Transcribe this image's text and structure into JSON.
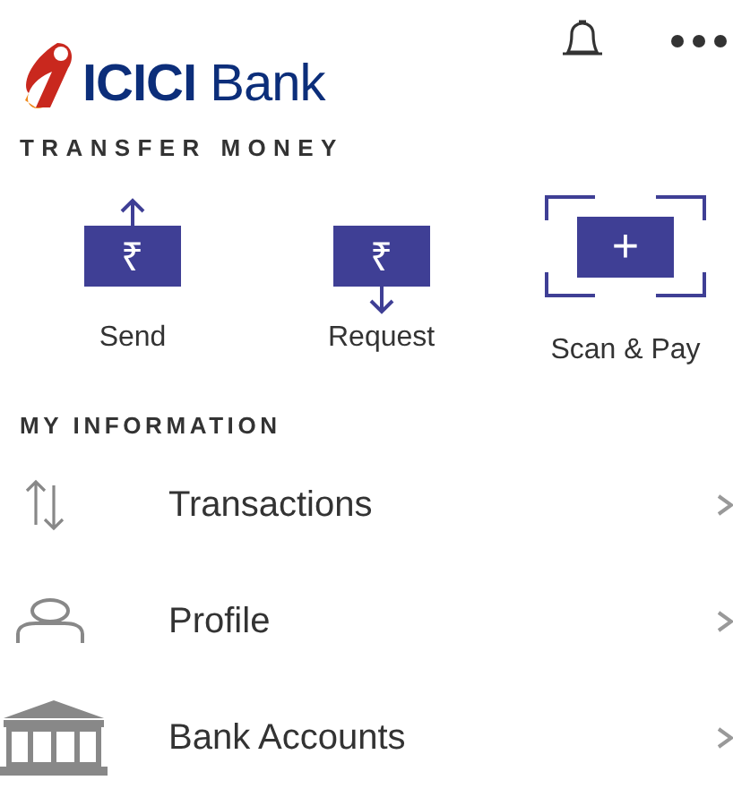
{
  "header": {
    "logo_text": "**ICICI** Bank"
  },
  "transfer_money": {
    "title": "TRANSFER MONEY",
    "actions": [
      {
        "kind": "send",
        "glyph": "₹",
        "label": "Send"
      },
      {
        "kind": "request",
        "glyph": "₹",
        "label": "Request"
      },
      {
        "kind": "scan",
        "glyph": "+",
        "label": "Scan & Pay"
      }
    ]
  },
  "my_information": {
    "title": "MY INFORMATION",
    "items": [
      {
        "kind": "transactions",
        "label": "Transactions"
      },
      {
        "kind": "profile",
        "label": "Profile"
      },
      {
        "kind": "bank",
        "label": "Bank Accounts"
      }
    ]
  }
}
